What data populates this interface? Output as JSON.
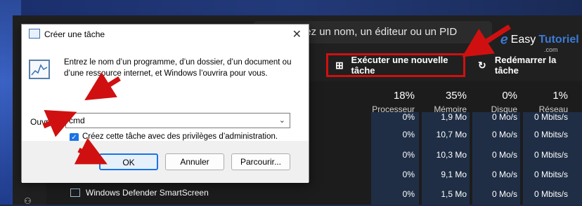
{
  "taskmanager": {
    "search_placeholder": "Recherchez un nom, un éditeur ou un PID",
    "run_new_task": "Exécuter une nouvelle tâche",
    "restart_task": "Redémarrer la tâche",
    "columns": [
      {
        "pct": "18%",
        "label": "Processeur"
      },
      {
        "pct": "35%",
        "label": "Mémoire"
      },
      {
        "pct": "0%",
        "label": "Disque"
      },
      {
        "pct": "1%",
        "label": "Réseau"
      }
    ],
    "rows": [
      [
        "0%",
        "1,9 Mo",
        "0 Mo/s",
        "0 Mbits/s"
      ],
      [
        "0%",
        "10,7 Mo",
        "0 Mo/s",
        "0 Mbits/s"
      ],
      [
        "0%",
        "10,3 Mo",
        "0 Mo/s",
        "0 Mbits/s"
      ],
      [
        "0%",
        "9,1 Mo",
        "0 Mo/s",
        "0 Mbits/s"
      ],
      [
        "0%",
        "1,5 Mo",
        "0 Mo/s",
        "0 Mbits/s"
      ]
    ],
    "visible_app": "Windows Defender SmartScreen"
  },
  "logo": {
    "brand_plain": "Easy",
    "brand_accent": "Tutoriel",
    "sub": ".com"
  },
  "dialog": {
    "title": "Créer une tâche",
    "description": "Entrez le nom d’un programme, d’un dossier, d’un document ou d’une ressource internet, et Windows l’ouvrira pour vous.",
    "open_label": "Ouvrir :",
    "open_value": "cmd",
    "admin_checkbox_label": "Créez cette tâche avec des privilèges d’administration.",
    "admin_checked": true,
    "ok": "OK",
    "cancel": "Annuler",
    "browse": "Parcourir..."
  },
  "colors": {
    "highlight_red": "#d01010",
    "accent_blue": "#1a73e8"
  }
}
